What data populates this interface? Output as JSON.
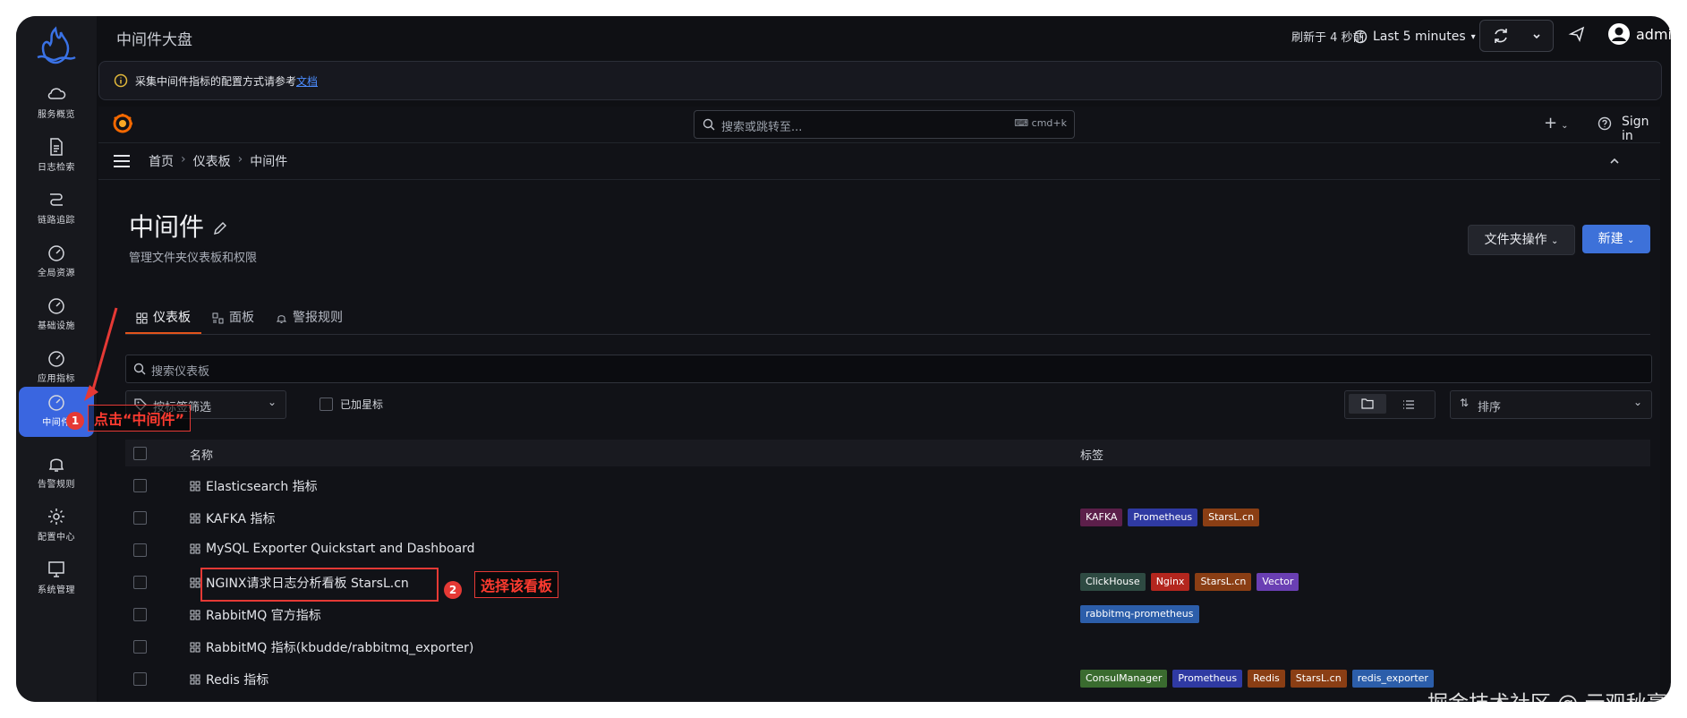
{
  "app": {
    "title": "中间件大盘"
  },
  "header": {
    "refresh_text": "刷新于 4 秒前",
    "time_range": "Last 5 minutes",
    "user": "admin"
  },
  "left_nav": [
    {
      "label": "服务概览",
      "icon": "cloud-icon"
    },
    {
      "label": "日志检索",
      "icon": "document-icon"
    },
    {
      "label": "链路追踪",
      "icon": "trace-icon"
    },
    {
      "label": "全局资源",
      "icon": "gauge-icon"
    },
    {
      "label": "基础设施",
      "icon": "gauge-icon"
    },
    {
      "label": "应用指标",
      "icon": "gauge-icon"
    },
    {
      "label": "中间件",
      "icon": "gauge-icon"
    },
    {
      "label": "告警规则",
      "icon": "bell-icon"
    },
    {
      "label": "配置中心",
      "icon": "gear-icon"
    },
    {
      "label": "系统管理",
      "icon": "monitor-icon"
    }
  ],
  "banner": {
    "text": "采集中间件指标的配置方式请参考",
    "link": "文档"
  },
  "grafana": {
    "search_placeholder": "搜索或跳转至...",
    "search_shortcut": "cmd+k",
    "sign_in": "Sign in",
    "breadcrumb": [
      "首页",
      "仪表板",
      "中间件"
    ],
    "page_title": "中间件",
    "page_subtitle": "管理文件夹仪表板和权限",
    "folder_actions": "文件夹操作",
    "new_button": "新建",
    "tabs": [
      "仪表板",
      "面板",
      "警报规则"
    ],
    "dash_search_placeholder": "搜索仪表板",
    "tag_filter_placeholder": "按标签筛选",
    "starred_label": "已加星标",
    "sort_placeholder": "排序",
    "table_headers": {
      "name": "名称",
      "tags": "标签"
    },
    "rows": [
      {
        "name": "Elasticsearch 指标",
        "tags": []
      },
      {
        "name": "KAFKA 指标",
        "tags": [
          {
            "text": "KAFKA",
            "color": "#5c1f4a"
          },
          {
            "text": "Prometheus",
            "color": "#2f3aa3"
          },
          {
            "text": "StarsL.cn",
            "color": "#8a3e14"
          }
        ]
      },
      {
        "name": "MySQL Exporter Quickstart and Dashboard",
        "tags": []
      },
      {
        "name": "NGINX请求日志分析看板 StarsL.cn",
        "tags": [
          {
            "text": "ClickHouse",
            "color": "#2e4a42"
          },
          {
            "text": "Nginx",
            "color": "#b3261e"
          },
          {
            "text": "StarsL.cn",
            "color": "#8a3e14"
          },
          {
            "text": "Vector",
            "color": "#6a3fb3"
          }
        ]
      },
      {
        "name": "RabbitMQ 官方指标",
        "tags": [
          {
            "text": "rabbitmq-prometheus",
            "color": "#2c5eaa"
          }
        ]
      },
      {
        "name": "RabbitMQ 指标(kbudde/rabbitmq_exporter)",
        "tags": []
      },
      {
        "name": "Redis 指标",
        "tags": [
          {
            "text": "ConsulManager",
            "color": "#3a6b2f"
          },
          {
            "text": "Prometheus",
            "color": "#2f3aa3"
          },
          {
            "text": "Redis",
            "color": "#8a3e14"
          },
          {
            "text": "StarsL.cn",
            "color": "#8a3e14"
          },
          {
            "text": "redis_exporter",
            "color": "#2c5eaa"
          }
        ]
      }
    ]
  },
  "annotations": {
    "step1_num": "1",
    "step1_text": "点击“中间件”",
    "step2_num": "2",
    "step2_text": "选择该看板"
  },
  "watermark": "掘金技术社区 @ 云观秋毫"
}
